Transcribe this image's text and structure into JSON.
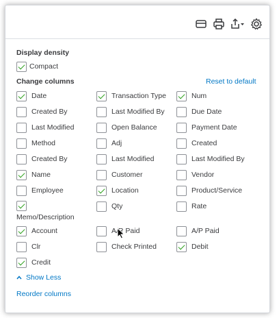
{
  "toolbar": {
    "icons": [
      "email-icon",
      "print-icon",
      "export-icon",
      "gear-icon"
    ]
  },
  "display_density": {
    "title": "Display density",
    "compact_label": "Compact",
    "compact_checked": true
  },
  "change_columns": {
    "title": "Change columns",
    "reset_label": "Reset to default",
    "rows": [
      [
        {
          "label": "Date",
          "checked": true
        },
        {
          "label": "Transaction Type",
          "checked": true
        },
        {
          "label": "Num",
          "checked": true
        }
      ],
      [
        {
          "label": "Created By",
          "checked": false
        },
        {
          "label": "Last Modified By",
          "checked": false
        },
        {
          "label": "Due Date",
          "checked": false
        }
      ],
      [
        {
          "label": "Last Modified",
          "checked": false
        },
        {
          "label": "Open Balance",
          "checked": false
        },
        {
          "label": "Payment Date",
          "checked": false
        }
      ],
      [
        {
          "label": "Method",
          "checked": false
        },
        {
          "label": "Adj",
          "checked": false
        },
        {
          "label": "Created",
          "checked": false
        }
      ],
      [
        {
          "label": "Created By",
          "checked": false
        },
        {
          "label": "Last Modified",
          "checked": false
        },
        {
          "label": "Last Modified By",
          "checked": false
        }
      ],
      [
        {
          "label": "Name",
          "checked": true
        },
        {
          "label": "Customer",
          "checked": false
        },
        {
          "label": "Vendor",
          "checked": false
        }
      ],
      [
        {
          "label": "Employee",
          "checked": false
        },
        {
          "label": "Location",
          "checked": true
        },
        {
          "label": "Product/Service",
          "checked": false
        }
      ],
      [
        {
          "label": "Memo/Description",
          "checked": true
        },
        {
          "label": "Qty",
          "checked": false
        },
        {
          "label": "Rate",
          "checked": false
        }
      ],
      [
        {
          "label": "Account",
          "checked": true
        },
        {
          "label": "A/R Paid",
          "checked": false
        },
        {
          "label": "A/P Paid",
          "checked": false
        }
      ],
      [
        {
          "label": "Clr",
          "checked": false
        },
        {
          "label": "Check Printed",
          "checked": false
        },
        {
          "label": "Debit",
          "checked": true
        }
      ],
      [
        {
          "label": "Credit",
          "checked": true
        }
      ]
    ]
  },
  "show_less_label": "Show Less",
  "reorder_label": "Reorder columns"
}
